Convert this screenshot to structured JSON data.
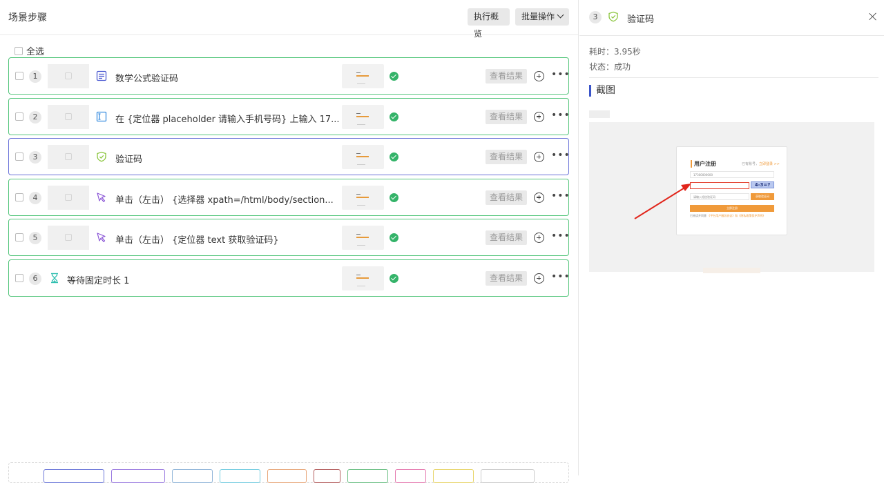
{
  "header": {
    "title": "场景步骤",
    "overview_label": "执行概览",
    "batch_label": "批量操作"
  },
  "select_all_label": "全选",
  "steps": [
    {
      "index": "1",
      "icon": "document-icon",
      "text": "数学公式验证码",
      "view_label": "查看结果",
      "status": "success"
    },
    {
      "index": "2",
      "icon": "input-icon",
      "text": "在 {定位器 placeholder 请输入手机号码} 上输入 17...",
      "view_label": "查看结果",
      "status": "success"
    },
    {
      "index": "3",
      "icon": "shield-check-icon",
      "text": "验证码",
      "view_label": "查看结果",
      "status": "success"
    },
    {
      "index": "4",
      "icon": "click-icon",
      "text": "单击（左击） {选择器   xpath=/html/body/section...",
      "view_label": "查看结果",
      "status": "success"
    },
    {
      "index": "5",
      "icon": "click-icon",
      "text": "单击（左击） {定位器 text 获取验证码}",
      "view_label": "查看结果",
      "status": "success"
    },
    {
      "index": "6",
      "icon": "hourglass-icon",
      "text": "等待固定时长 1",
      "view_label": "查看结果",
      "status": "success"
    }
  ],
  "detail": {
    "index": "3",
    "title": "验证码",
    "duration": "耗时：3.95秒",
    "status": "状态：成功",
    "section_title": "截图",
    "screenshot": {
      "form_title": "用户注册",
      "top_text": "已有账号，",
      "top_link": "立即登录 >>",
      "phone_value": "17300000000",
      "captcha_text": "4-3=?",
      "sms_placeholder": "请输入短信验证码",
      "get_code_label": "获取验证码",
      "register_label": "立即注册",
      "agree_text": "已阅读并同意",
      "agree_link": "《平台用户服务协议》和《隐私政策保护声明》"
    }
  },
  "colors": {
    "success_border": "#52c57a",
    "selected_border": "#6871d8",
    "success_dot": "#34b369",
    "accent_bar": "#3a54c9",
    "orange": "#f09a3a",
    "arrow_red": "#e1251b"
  },
  "toolbar_chip_colors": [
    "#6a76d8",
    "#9b7be0",
    "#8fb4d8",
    "#72cce0",
    "#e8a77a",
    "#b35c5c",
    "#6abf83",
    "#e57ab0",
    "#e8d56a",
    "#cccccc"
  ]
}
